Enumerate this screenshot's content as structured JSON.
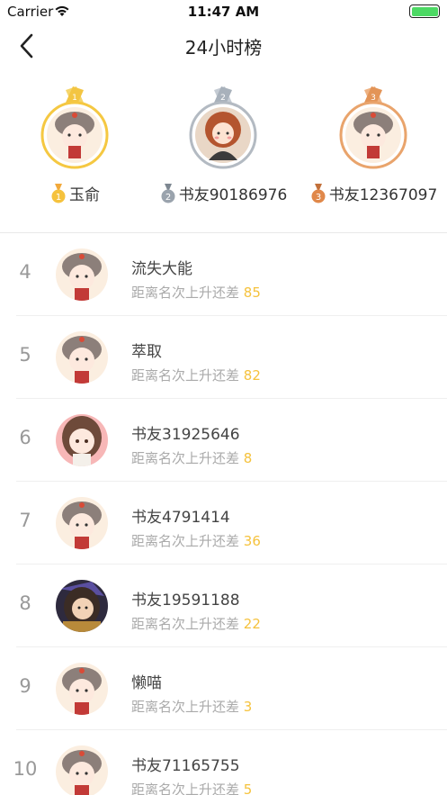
{
  "status_bar": {
    "carrier": "Carrier",
    "time": "11:47 AM"
  },
  "nav": {
    "title": "24小时榜"
  },
  "podium": [
    {
      "rank": "1",
      "name": "玉俞",
      "color": "#f5c842",
      "avatar": "girl-hairpin"
    },
    {
      "rank": "2",
      "name": "书友90186976",
      "color": "#9aa3ad",
      "avatar": "girl-red-hair"
    },
    {
      "rank": "3",
      "name": "书友12367097",
      "color": "#e79b5c",
      "avatar": "girl-hairpin"
    }
  ],
  "list": {
    "gap_prefix": "距离名次上升还差",
    "rows": [
      {
        "rank": "4",
        "name": "流失大能",
        "gap": "85",
        "avatar": "girl-hairpin"
      },
      {
        "rank": "5",
        "name": "萃取",
        "gap": "82",
        "avatar": "girl-hairpin"
      },
      {
        "rank": "6",
        "name": "书友31925646",
        "gap": "8",
        "avatar": "girl-brown-hair"
      },
      {
        "rank": "7",
        "name": "书友4791414",
        "gap": "36",
        "avatar": "girl-hairpin"
      },
      {
        "rank": "8",
        "name": "书友19591188",
        "gap": "22",
        "avatar": "dark-anime"
      },
      {
        "rank": "9",
        "name": "懒喵",
        "gap": "3",
        "avatar": "girl-hairpin"
      },
      {
        "rank": "10",
        "name": "书友71165755",
        "gap": "5",
        "avatar": "girl-hairpin"
      }
    ]
  },
  "colors": {
    "accent_gap_number": "#f5c23d",
    "battery": "#4cd964"
  }
}
